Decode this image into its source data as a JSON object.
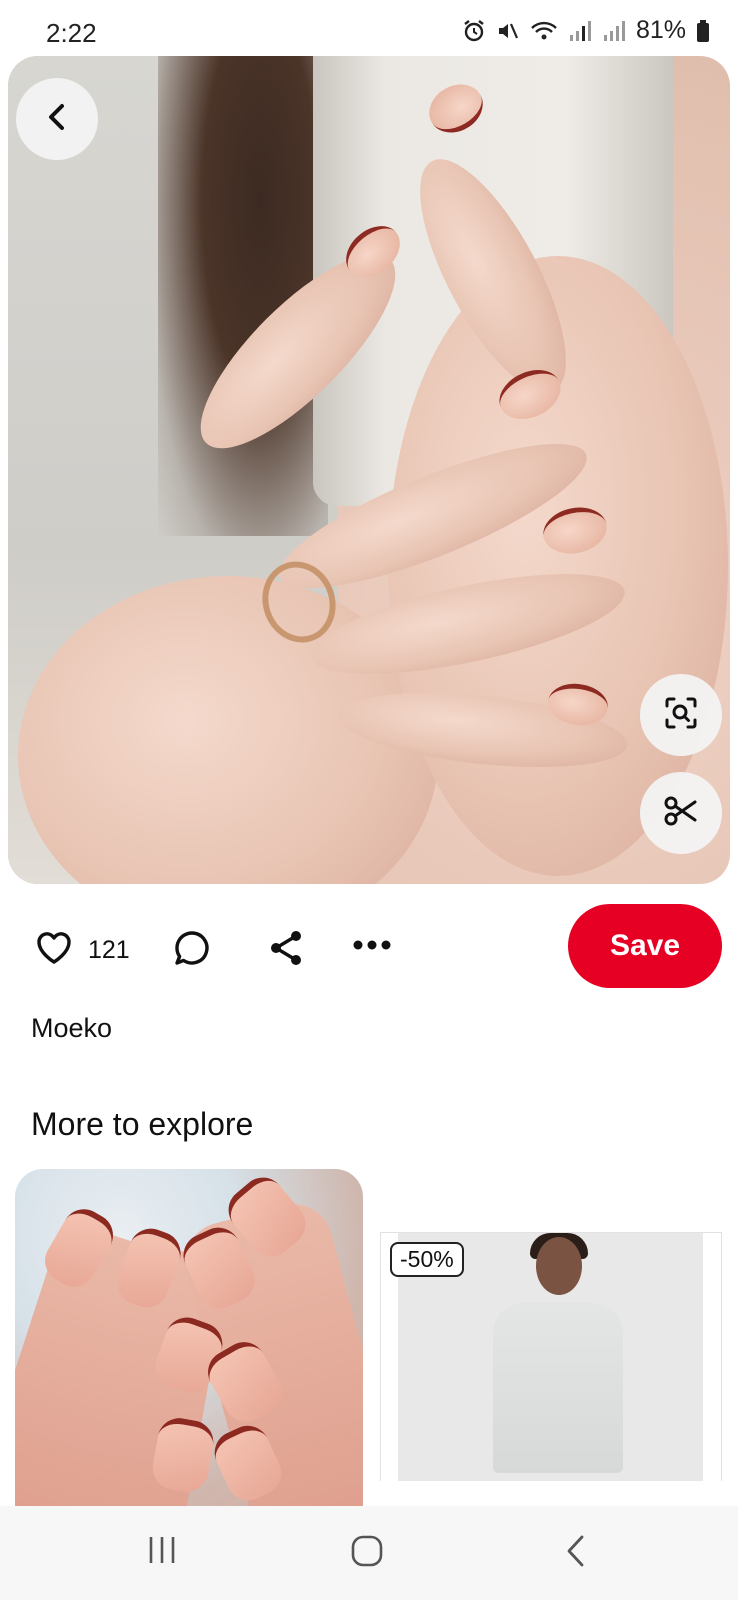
{
  "status_bar": {
    "time": "2:22",
    "battery_percent": "81%",
    "icons": [
      "alarm-icon",
      "mute-icon",
      "wifi-icon",
      "signal-icon",
      "signal-icon",
      "battery-icon"
    ]
  },
  "pin": {
    "image_description_icon": "nails-photo",
    "like_count": "121",
    "author": "Moeko"
  },
  "actions": {
    "save_label": "Save",
    "save_color": "#e60023"
  },
  "explore": {
    "title": "More to explore",
    "cards": [
      {
        "type": "pin"
      },
      {
        "type": "product",
        "badge": "-50%"
      }
    ]
  },
  "nav": {
    "items": [
      "recent-apps-icon",
      "home-icon",
      "back-icon"
    ]
  }
}
